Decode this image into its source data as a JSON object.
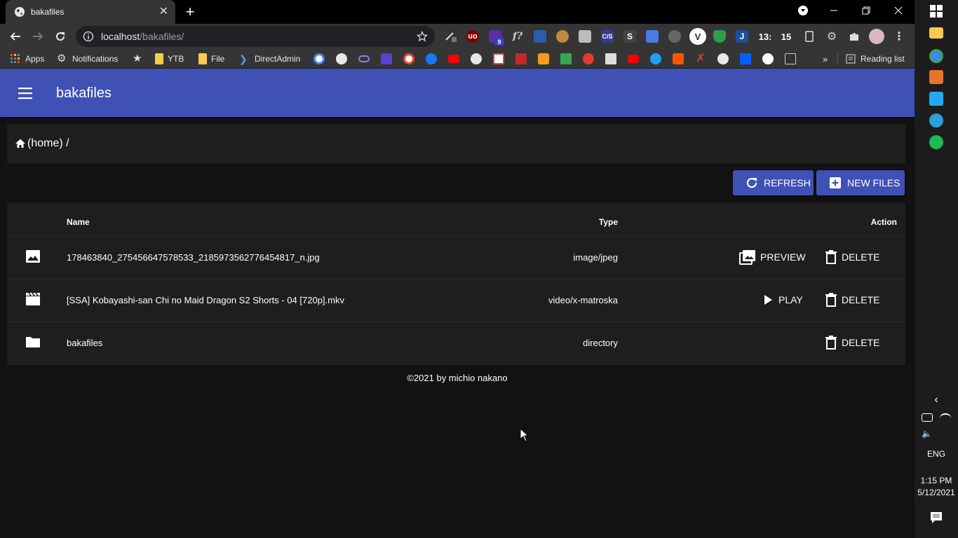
{
  "browser": {
    "tab_title": "bakafiles",
    "url_host": "localhost",
    "url_path": "/bakafiles/",
    "ext_counter_a": "13:",
    "ext_counter_b": "15",
    "ext_badge": "9"
  },
  "bookmarks": {
    "items": [
      {
        "label": "Apps"
      },
      {
        "label": "Notifications"
      },
      {
        "label": "YTB"
      },
      {
        "label": "File"
      },
      {
        "label": "DirectAdmin"
      }
    ],
    "reading_list": "Reading list",
    "overflow": "»"
  },
  "app": {
    "title": "bakafiles",
    "breadcrumb": "(home) /",
    "refresh_label": "REFRESH",
    "new_files_label": "NEW FILES",
    "columns": {
      "name": "Name",
      "type": "Type",
      "action": "Action"
    },
    "files": [
      {
        "icon": "image-icon",
        "name": "178463840_275456647578533_2185973562776454817_n.jpg",
        "type": "image/jpeg",
        "primary_action": "PREVIEW",
        "delete": "DELETE"
      },
      {
        "icon": "movie-icon",
        "name": "[SSA] Kobayashi-san Chi no Maid Dragon S2 Shorts - 04 [720p].mkv",
        "type": "video/x-matroska",
        "primary_action": "PLAY",
        "delete": "DELETE"
      },
      {
        "icon": "folder-icon",
        "name": "bakafiles",
        "type": "directory",
        "primary_action": "",
        "delete": "DELETE"
      }
    ],
    "footer": "©2021 by michio nakano"
  },
  "taskbar": {
    "language": "ENG",
    "time": "1:15 PM",
    "date": "5/12/2021"
  },
  "colors": {
    "app_bar": "#3f51b5",
    "background": "#121212",
    "card": "#1e1e1e"
  }
}
